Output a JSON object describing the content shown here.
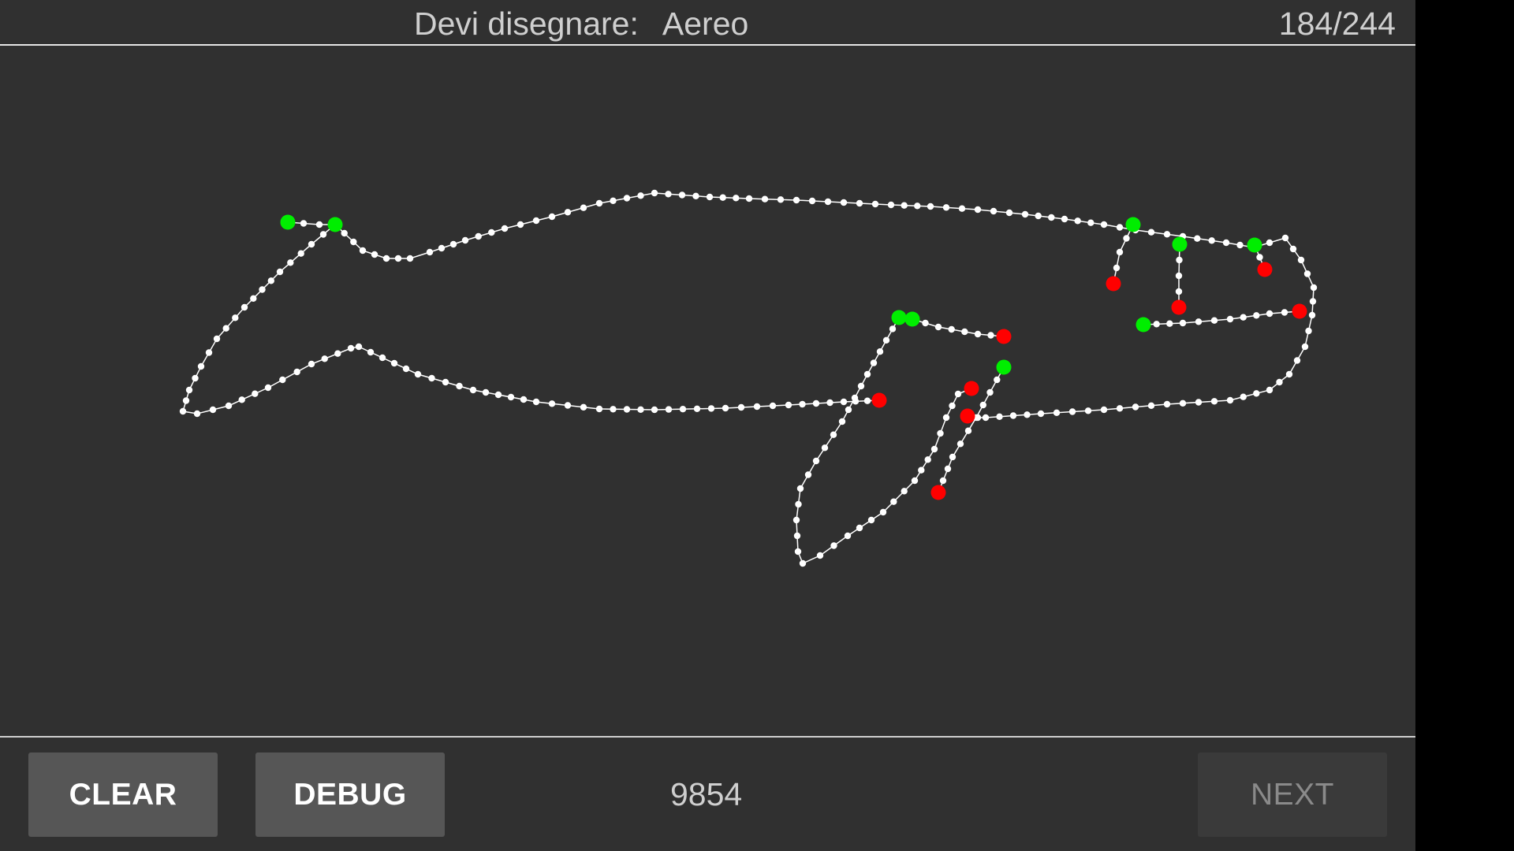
{
  "header": {
    "prompt_label": "Devi disegnare:",
    "prompt_target": "Aereo",
    "counter": "184/244"
  },
  "footer": {
    "clear_label": "CLEAR",
    "debug_label": "DEBUG",
    "score": "9854",
    "next_label": "NEXT"
  },
  "colors": {
    "background": "#303030",
    "stroke_point": "#ffffff",
    "stroke_start": "#00ee00",
    "stroke_end": "#ff0000"
  }
}
